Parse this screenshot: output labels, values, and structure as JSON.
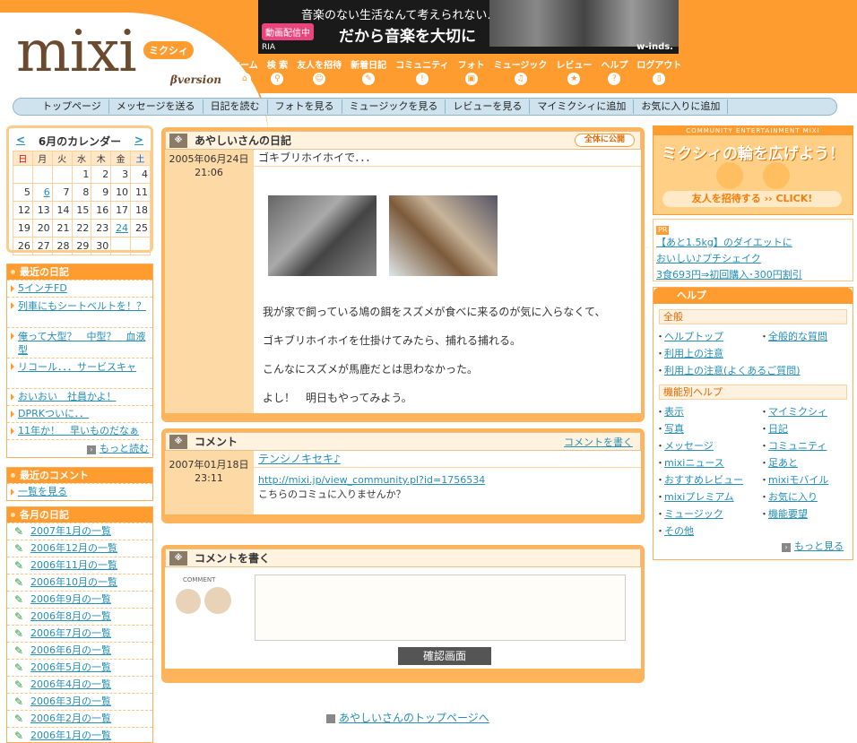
{
  "header": {
    "logo": "mixi",
    "logo_badge": "ミクシィ",
    "logo_version": "βversion",
    "banner": {
      "tag": "動画配信中",
      "line1": "音楽のない生活なんて考えられない…",
      "line2": "だから音楽を大切に",
      "brand": "w-inds.",
      "ria": "RIA"
    },
    "nav": [
      "ホーム",
      "検 索",
      "友人を招待",
      "新着日記",
      "コミュニティ",
      "フォト",
      "ミュージック",
      "レビュー",
      "ヘルプ",
      "ログアウト"
    ]
  },
  "subnav": [
    "トップページ",
    "メッセージを送る",
    "日記を読む",
    "フォトを見る",
    "ミュージックを見る",
    "レビューを見る",
    "マイミクシィに追加",
    "お気に入りに追加"
  ],
  "calendar": {
    "prev": "<",
    "title": "6月のカレンダー",
    "next": ">",
    "weekdays": [
      "日",
      "月",
      "火",
      "水",
      "木",
      "金",
      "土"
    ],
    "weeks": [
      [
        "",
        "",
        "",
        "1",
        "2",
        "3",
        "4"
      ],
      [
        "5",
        "6",
        "7",
        "8",
        "9",
        "10",
        "11"
      ],
      [
        "12",
        "13",
        "14",
        "15",
        "16",
        "17",
        "18"
      ],
      [
        "19",
        "20",
        "21",
        "22",
        "23",
        "24",
        "25"
      ],
      [
        "26",
        "27",
        "28",
        "29",
        "30",
        "",
        ""
      ]
    ],
    "linked_days": [
      "6",
      "24"
    ]
  },
  "recent_diary": {
    "title": "最近の日記",
    "items": [
      "5インチFD",
      "列車にもシートベルトを！？",
      "俺って大型？　中型？　血液型",
      "リコール．．．サービスキャ",
      "おいおい　社員かよ！",
      "DPRKついに．．",
      "11年か！　早いものだなぁ"
    ],
    "more": "もっと読む"
  },
  "recent_comments": {
    "title": "最近のコメント",
    "items": [
      "一覧を見る"
    ]
  },
  "monthly": {
    "title": "各月の日記",
    "items": [
      "2007年1月の一覧",
      "2006年12月の一覧",
      "2006年11月の一覧",
      "2006年10月の一覧",
      "2006年9月の一覧",
      "2006年8月の一覧",
      "2006年7月の一覧",
      "2006年6月の一覧",
      "2006年5月の一覧",
      "2006年4月の一覧",
      "2006年3月の一覧",
      "2006年2月の一覧",
      "2006年1月の一覧"
    ]
  },
  "diary": {
    "header": "あやしいさんの日記",
    "visibility": "全体に公開",
    "date": "2005年06月24日",
    "time": "21:06",
    "title": "ゴキブリホイホイで．．．",
    "paragraphs": [
      "我が家で飼っている鳩の餌をスズメが食べに来るのが気に入らなくて、",
      "ゴキブリホイホイを仕掛けてみたら、捕れる捕れる。",
      "こんなにスズメが馬鹿だとは思わなかった。",
      "よし！　明日もやってみよう。"
    ]
  },
  "comments": {
    "header": "コメント",
    "write_link": "コメントを書く",
    "items": [
      {
        "date": "2007年01月18日",
        "time": "23:11",
        "author": "テンシノキセキ♪",
        "url": "http://mixi.jp/view_community.pl?id=1756534",
        "text": "こちらのコミュに入りませんか？"
      }
    ]
  },
  "comment_form": {
    "header": "コメントを書く",
    "label": "COMMENT",
    "submit": "確認画面"
  },
  "top_link": "あやしいさんのトップページへ",
  "right_banner": {
    "top": "COMMUNITY ENTERTAINMENT MIXI",
    "main": "ミクシィの輪を広げよう！",
    "cta": "友人を招待する ›› CLICK!"
  },
  "pr": {
    "tag": "PR",
    "lines": [
      "【あと1.5kg】のダイエットに",
      "おいしい♪プチシェイク",
      "3食693円⇒初回購入･300円割引"
    ]
  },
  "help": {
    "title": "ヘルプ",
    "section1": "全般",
    "general": [
      "ヘルプトップ",
      "全般的な質問",
      "利用上の注意",
      "",
      "利用上の注意(よくあるご質問)"
    ],
    "section2": "機能別ヘルプ",
    "features": [
      "表示",
      "マイミクシィ",
      "写真",
      "日記",
      "メッセージ",
      "コミュニティ",
      "mixiニュース",
      "足あと",
      "おすすめレビュー",
      "mixiモバイル",
      "mixiプレミアム",
      "お気に入り",
      "ミュージック",
      "機能要望",
      "その他"
    ],
    "more": "もっと見る"
  }
}
